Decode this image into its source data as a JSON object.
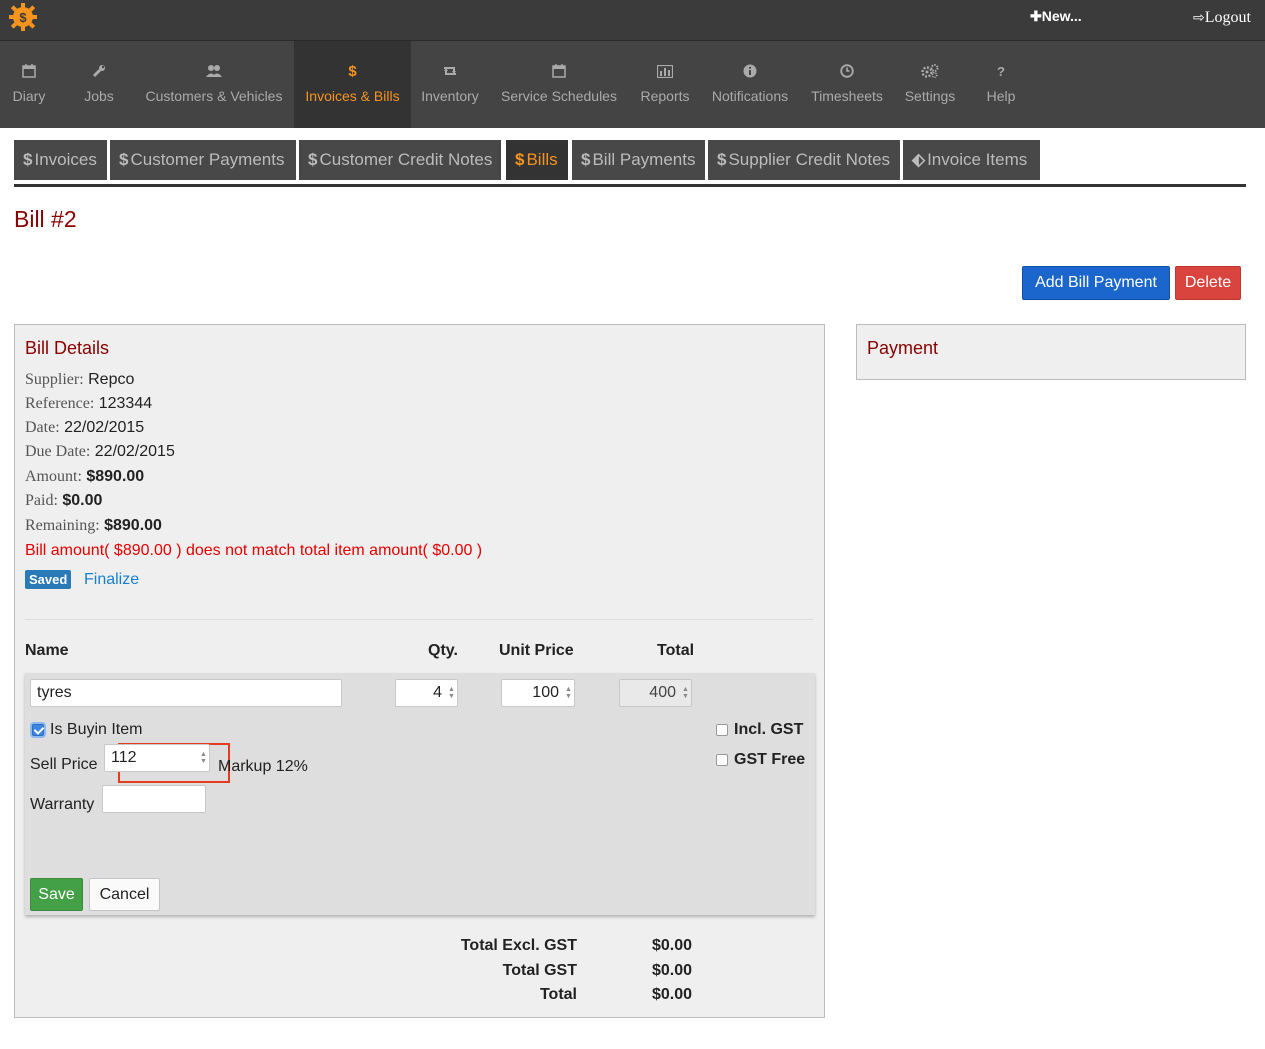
{
  "topbar": {
    "new_label": "New...",
    "logout_label": "Logout"
  },
  "nav": [
    {
      "label": "Diary",
      "icon": "calendar-icon"
    },
    {
      "label": "Jobs",
      "icon": "wrench-icon"
    },
    {
      "label": "Customers & Vehicles",
      "icon": "users-icon"
    },
    {
      "label": "Invoices & Bills",
      "icon": "dollar-icon"
    },
    {
      "label": "Inventory",
      "icon": "retweet-icon"
    },
    {
      "label": "Service Schedules",
      "icon": "calendar-icon"
    },
    {
      "label": "Reports",
      "icon": "bar-chart-icon"
    },
    {
      "label": "Notifications",
      "icon": "info-icon"
    },
    {
      "label": "Timesheets",
      "icon": "clock-icon"
    },
    {
      "label": "Settings",
      "icon": "gears-icon"
    },
    {
      "label": "Help",
      "icon": "question-icon"
    }
  ],
  "subtabs": [
    {
      "label": "Invoices"
    },
    {
      "label": "Customer Payments"
    },
    {
      "label": "Customer Credit Notes"
    },
    {
      "label": "Bills"
    },
    {
      "label": "Bill Payments"
    },
    {
      "label": "Supplier Credit Notes"
    },
    {
      "label": "Invoice Items"
    }
  ],
  "page": {
    "title": "Bill #2",
    "add_payment_label": "Add Bill Payment",
    "delete_label": "Delete"
  },
  "bill_details": {
    "heading": "Bill Details",
    "supplier_label": "Supplier:",
    "supplier": "Repco",
    "reference_label": "Reference:",
    "reference": "123344",
    "date_label": "Date:",
    "date": "22/02/2015",
    "due_label": "Due Date:",
    "due": "22/02/2015",
    "amount_label": "Amount:",
    "amount": "$890.00",
    "paid_label": "Paid:",
    "paid": "$0.00",
    "remaining_label": "Remaining:",
    "remaining": "$890.00",
    "warning": "Bill amount( $890.00 ) does not match total item amount( $0.00 )",
    "status_badge": "Saved",
    "finalize_label": "Finalize"
  },
  "items_table": {
    "col_name": "Name",
    "col_qty": "Qty.",
    "col_unit_price": "Unit Price",
    "col_total": "Total",
    "row": {
      "name": "tyres",
      "qty": "4",
      "unit_price": "100",
      "total": "400"
    },
    "is_buyin_label": "Is Buyin Item",
    "is_buyin_checked": true,
    "incl_gst_label": "Incl. GST",
    "gst_free_label": "GST Free",
    "sell_price_label": "Sell Price",
    "sell_price": "112",
    "markup_label": "Markup 12%",
    "warranty_label": "Warranty",
    "warranty": "",
    "save_label": "Save",
    "cancel_label": "Cancel"
  },
  "totals": {
    "excl_gst_label": "Total Excl. GST",
    "excl_gst": "$0.00",
    "gst_label": "Total GST",
    "gst": "$0.00",
    "total_label": "Total",
    "total": "$0.00"
  },
  "payment_panel": {
    "heading": "Payment"
  },
  "colors": {
    "accent_orange": "#f7941d",
    "title_red": "#8b0000",
    "primary_blue": "#1a66cc",
    "danger_red": "#d9443f",
    "save_green": "#43a047",
    "warning_red": "#e60000",
    "highlight_border": "#e53b1f"
  }
}
